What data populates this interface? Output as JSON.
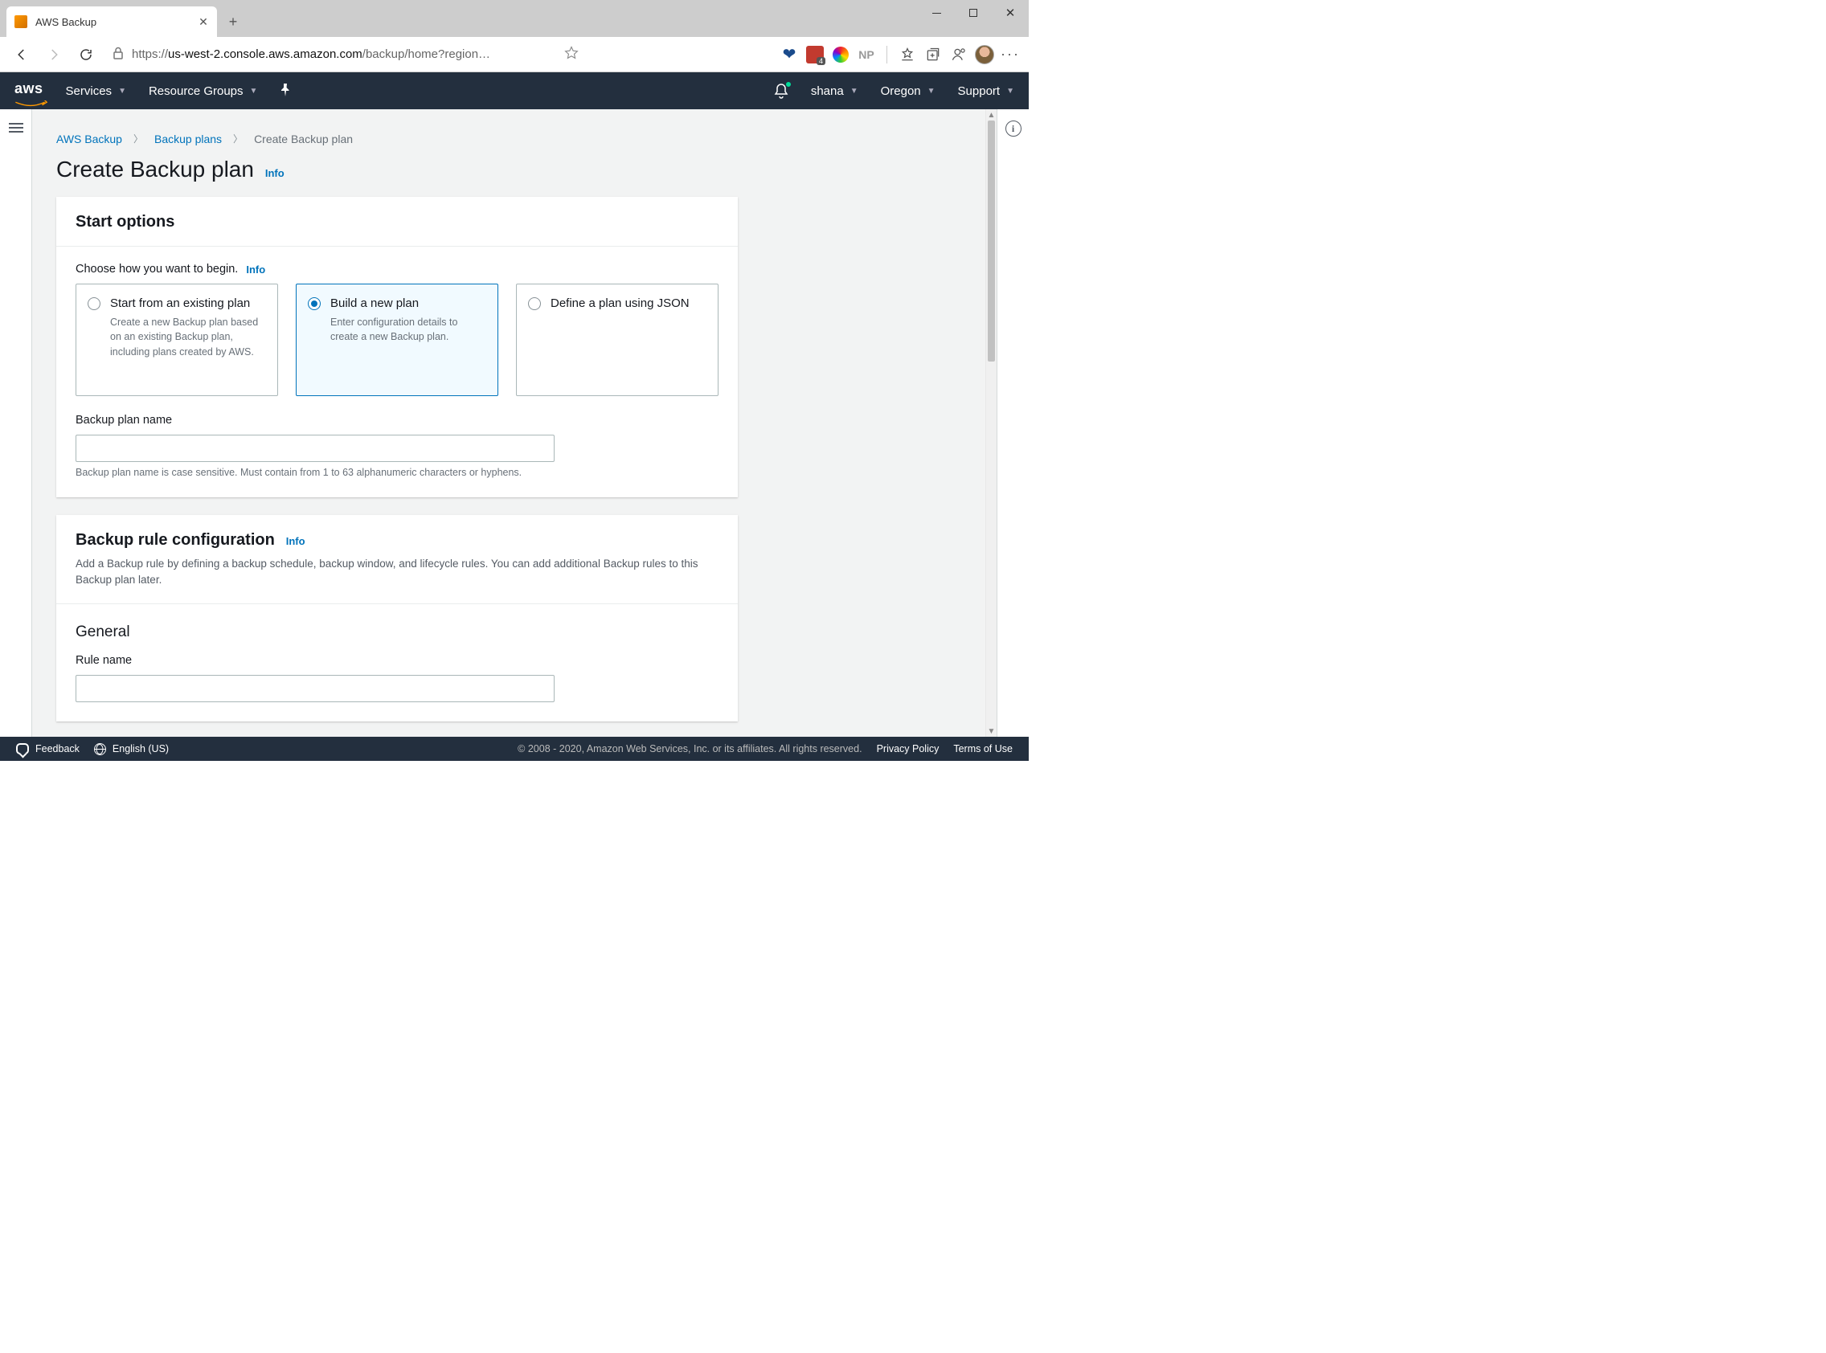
{
  "browser": {
    "tab_title": "AWS Backup",
    "url_prefix": "https://",
    "url_host": "us-west-2.console.aws.amazon.com",
    "url_path": "/backup/home?region…",
    "ext_np": "NP"
  },
  "nav": {
    "logo": "aws",
    "services": "Services",
    "resource_groups": "Resource Groups",
    "user": "shana",
    "region": "Oregon",
    "support": "Support"
  },
  "breadcrumbs": {
    "root": "AWS Backup",
    "plans": "Backup plans",
    "current": "Create Backup plan"
  },
  "page": {
    "title": "Create Backup plan",
    "info": "Info"
  },
  "start_options": {
    "header": "Start options",
    "choose_label": "Choose how you want to begin.",
    "info": "Info",
    "opt1_title": "Start from an existing plan",
    "opt1_desc": "Create a new Backup plan based on an existing Backup plan, including plans created by AWS.",
    "opt2_title": "Build a new plan",
    "opt2_desc": "Enter configuration details to create a new Backup plan.",
    "opt3_title": "Define a plan using JSON",
    "plan_name_label": "Backup plan name",
    "plan_name_helper": "Backup plan name is case sensitive. Must contain from 1 to 63 alphanumeric characters or hyphens."
  },
  "rule_config": {
    "header": "Backup rule configuration",
    "info": "Info",
    "desc": "Add a Backup rule by defining a backup schedule, backup window, and lifecycle rules. You can add additional Backup rules to this Backup plan later.",
    "general": "General",
    "rule_name_label": "Rule name"
  },
  "footer": {
    "feedback": "Feedback",
    "language": "English (US)",
    "copyright": "© 2008 - 2020, Amazon Web Services, Inc. or its affiliates. All rights reserved.",
    "privacy": "Privacy Policy",
    "terms": "Terms of Use"
  }
}
